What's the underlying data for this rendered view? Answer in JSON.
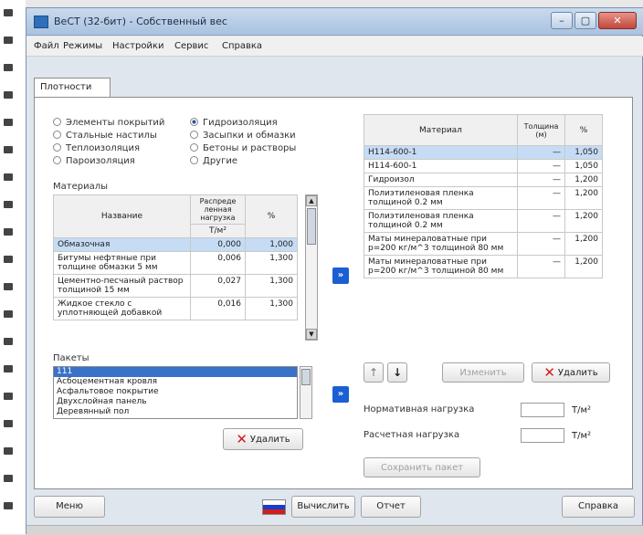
{
  "window": {
    "title": "ВеСТ (32-бит) - Собственный вес",
    "controls": [
      "–",
      "▢",
      "✕"
    ]
  },
  "menu": [
    "Файл",
    "Режимы",
    "Настройки",
    "Сервис",
    "Справка"
  ],
  "tab": "Плотности",
  "categories": {
    "left": [
      {
        "label": "Элементы покрытий",
        "selected": false
      },
      {
        "label": "Стальные настилы",
        "selected": false
      },
      {
        "label": "Теплоизоляция",
        "selected": false
      },
      {
        "label": "Пароизоляция",
        "selected": false
      }
    ],
    "right": [
      {
        "label": "Гидроизоляция",
        "selected": true
      },
      {
        "label": "Засыпки и обмазки",
        "selected": false
      },
      {
        "label": "Бетоны и растворы",
        "selected": false
      },
      {
        "label": "Другие",
        "selected": false
      }
    ]
  },
  "materials": {
    "label": "Материалы",
    "columns": {
      "name": "Название",
      "load": "Распреде ленная нагрузка",
      "load_unit": "Т/м²",
      "pct": "%"
    },
    "rows": [
      {
        "name": "Обмазочная",
        "load": "0,000",
        "pct": "1,000",
        "selected": true
      },
      {
        "name": "Битумы нефтяные при толщине обмазки 5 мм",
        "load": "0,006",
        "pct": "1,300",
        "selected": false
      },
      {
        "name": "Цементно-песчаный раствор толщиной 15 мм",
        "load": "0,027",
        "pct": "1,300",
        "selected": false
      },
      {
        "name": "Жидкое стекло с уплотняющей добавкой",
        "load": "0,016",
        "pct": "1,300",
        "selected": false
      }
    ]
  },
  "packets": {
    "label": "Пакеты",
    "items": [
      {
        "text": "111",
        "selected": true
      },
      {
        "text": "Асбоцементная кровля",
        "selected": false
      },
      {
        "text": "Асфальтовое покрытие",
        "selected": false
      },
      {
        "text": "Двухслойная панель",
        "selected": false
      },
      {
        "text": "Деревянный пол",
        "selected": false
      }
    ],
    "delete_label": "Удалить"
  },
  "layers": {
    "columns": {
      "material": "Материал",
      "thickness": "Толщина (м)",
      "pct": "%"
    },
    "rows": [
      {
        "material": "Н114-600-1",
        "thickness": "—",
        "pct": "1,050",
        "selected": true
      },
      {
        "material": "Н114-600-1",
        "thickness": "—",
        "pct": "1,050",
        "selected": false
      },
      {
        "material": "Гидроизол",
        "thickness": "—",
        "pct": "1,200",
        "selected": false
      },
      {
        "material": "Полиэтиленовая пленка толщиной 0.2 мм",
        "thickness": "—",
        "pct": "1,200",
        "selected": false
      },
      {
        "material": "Полиэтиленовая пленка толщиной 0.2 мм",
        "thickness": "—",
        "pct": "1,200",
        "selected": false
      },
      {
        "material": "Маты минераловатные при р=200 кг/м^3 толщиной 80 мм",
        "thickness": "—",
        "pct": "1,200",
        "selected": false
      },
      {
        "material": "Маты минераловатные при р=200 кг/м^3 толщиной 80 мм",
        "thickness": "—",
        "pct": "1,200",
        "selected": false
      }
    ]
  },
  "actions": {
    "up": "↑",
    "down": "↓",
    "edit": "Изменить",
    "delete": "Удалить",
    "move_label": "»"
  },
  "loads": {
    "normative_label": "Нормативная нагрузка",
    "normative_value": "",
    "design_label": "Расчетная нагрузка",
    "design_value": "",
    "unit": "Т/м²"
  },
  "save_packet": "Сохранить пакет",
  "bottom": {
    "menu": "Меню",
    "calculate": "Вычислить",
    "report": "Отчет",
    "help": "Справка"
  },
  "colors": {
    "accent": "#1a5fd3",
    "selection": "#c6dcf5",
    "delete": "#d01e1e"
  }
}
